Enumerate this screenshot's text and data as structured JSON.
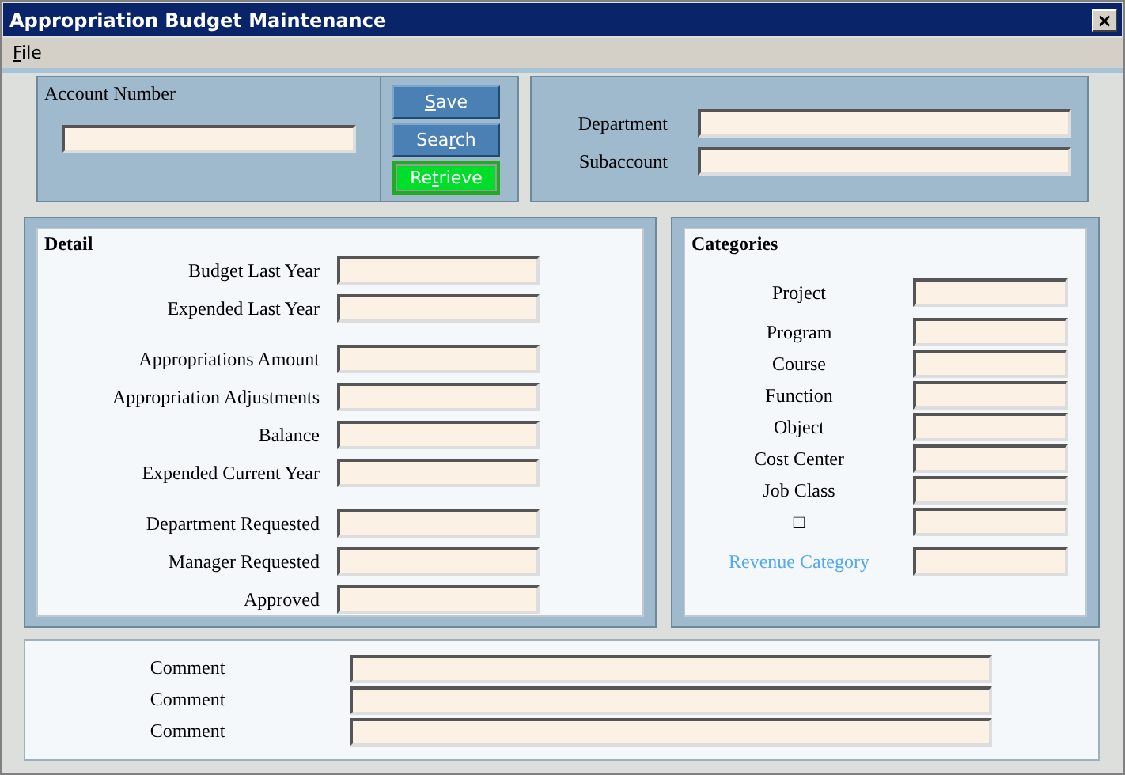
{
  "window": {
    "title": "Appropriation Budget Maintenance",
    "close": "×"
  },
  "menu": [
    {
      "key": "F",
      "post": "ile"
    }
  ],
  "account": {
    "label": "Account Number"
  },
  "buttons": [
    {
      "key": "S",
      "post": "ave",
      "kind": "normal"
    },
    {
      "pre": "Sea",
      "key": "r",
      "post": "ch",
      "kind": "normal"
    },
    {
      "pre": "Re",
      "key": "t",
      "post": "rieve",
      "kind": "highlight"
    }
  ],
  "header_fields": [
    {
      "label": "Department"
    },
    {
      "label": "Subaccount"
    }
  ],
  "detail": {
    "title": "Detail",
    "groups": [
      [
        {
          "label": "Budget Last Year"
        },
        {
          "label": "Expended Last Year"
        }
      ],
      [
        {
          "label": "Appropriations Amount"
        },
        {
          "label": "Appropriation Adjustments"
        },
        {
          "label": "Balance"
        },
        {
          "label": "Expended Current Year"
        }
      ],
      [
        {
          "label": "Department Requested"
        },
        {
          "label": "Manager Requested"
        },
        {
          "label": "Approved"
        }
      ]
    ]
  },
  "categories": {
    "title": "Categories",
    "groups": [
      [
        {
          "label": "Project",
          "kind": "plain"
        }
      ],
      [
        {
          "label": "Program",
          "kind": "plain"
        },
        {
          "label": "Course",
          "kind": "plain"
        },
        {
          "label": "Function",
          "kind": "plain"
        },
        {
          "label": "Object",
          "kind": "plain"
        },
        {
          "label": "Cost Center",
          "kind": "plain"
        },
        {
          "label": "Job Class",
          "kind": "plain"
        },
        {
          "label": "□",
          "kind": "plain"
        }
      ],
      [
        {
          "label": "Revenue Category",
          "kind": "link"
        }
      ]
    ]
  },
  "comments": [
    {
      "label": "Comment"
    },
    {
      "label": "Comment"
    },
    {
      "label": "Comment"
    }
  ]
}
